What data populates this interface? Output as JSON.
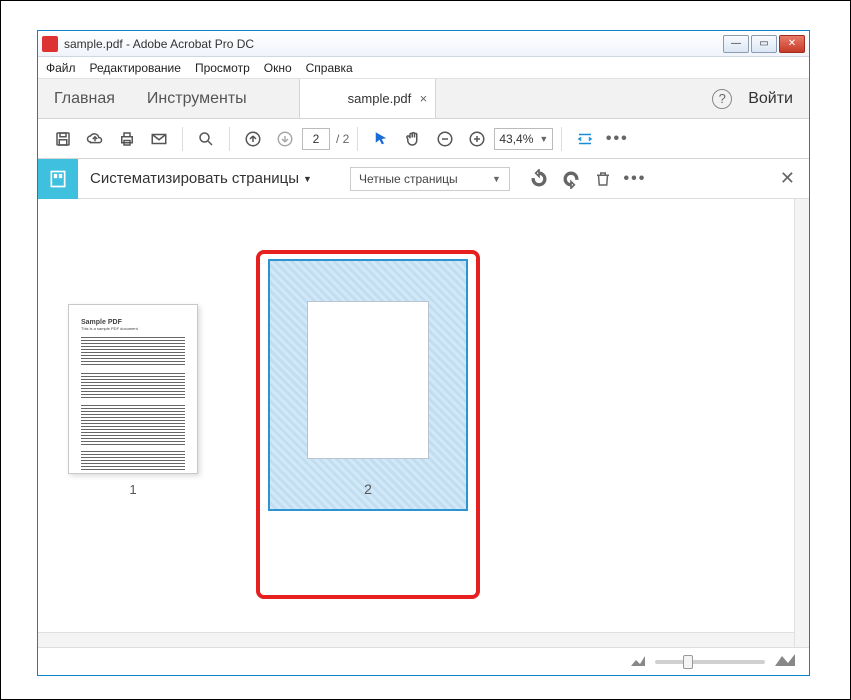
{
  "window": {
    "title": "sample.pdf - Adobe Acrobat Pro DC",
    "min": "—",
    "max": "▭",
    "close": "✕"
  },
  "menu": {
    "file": "Файл",
    "edit": "Редактирование",
    "view": "Просмотр",
    "window": "Окно",
    "help": "Справка"
  },
  "tabs": {
    "home": "Главная",
    "tools": "Инструменты",
    "doc": "sample.pdf",
    "close": "×",
    "help_q": "?",
    "login": "Войти"
  },
  "toolbar": {
    "page_current": "2",
    "page_total": "/ 2",
    "zoom": "43,4%"
  },
  "organize": {
    "title": "Систематизировать страницы",
    "filter": "Четные страницы",
    "close": "✕"
  },
  "thumbs": {
    "p1": {
      "num": "1",
      "title": "Sample PDF",
      "sub": "This is a sample PDF document"
    },
    "p2": {
      "num": "2"
    }
  }
}
